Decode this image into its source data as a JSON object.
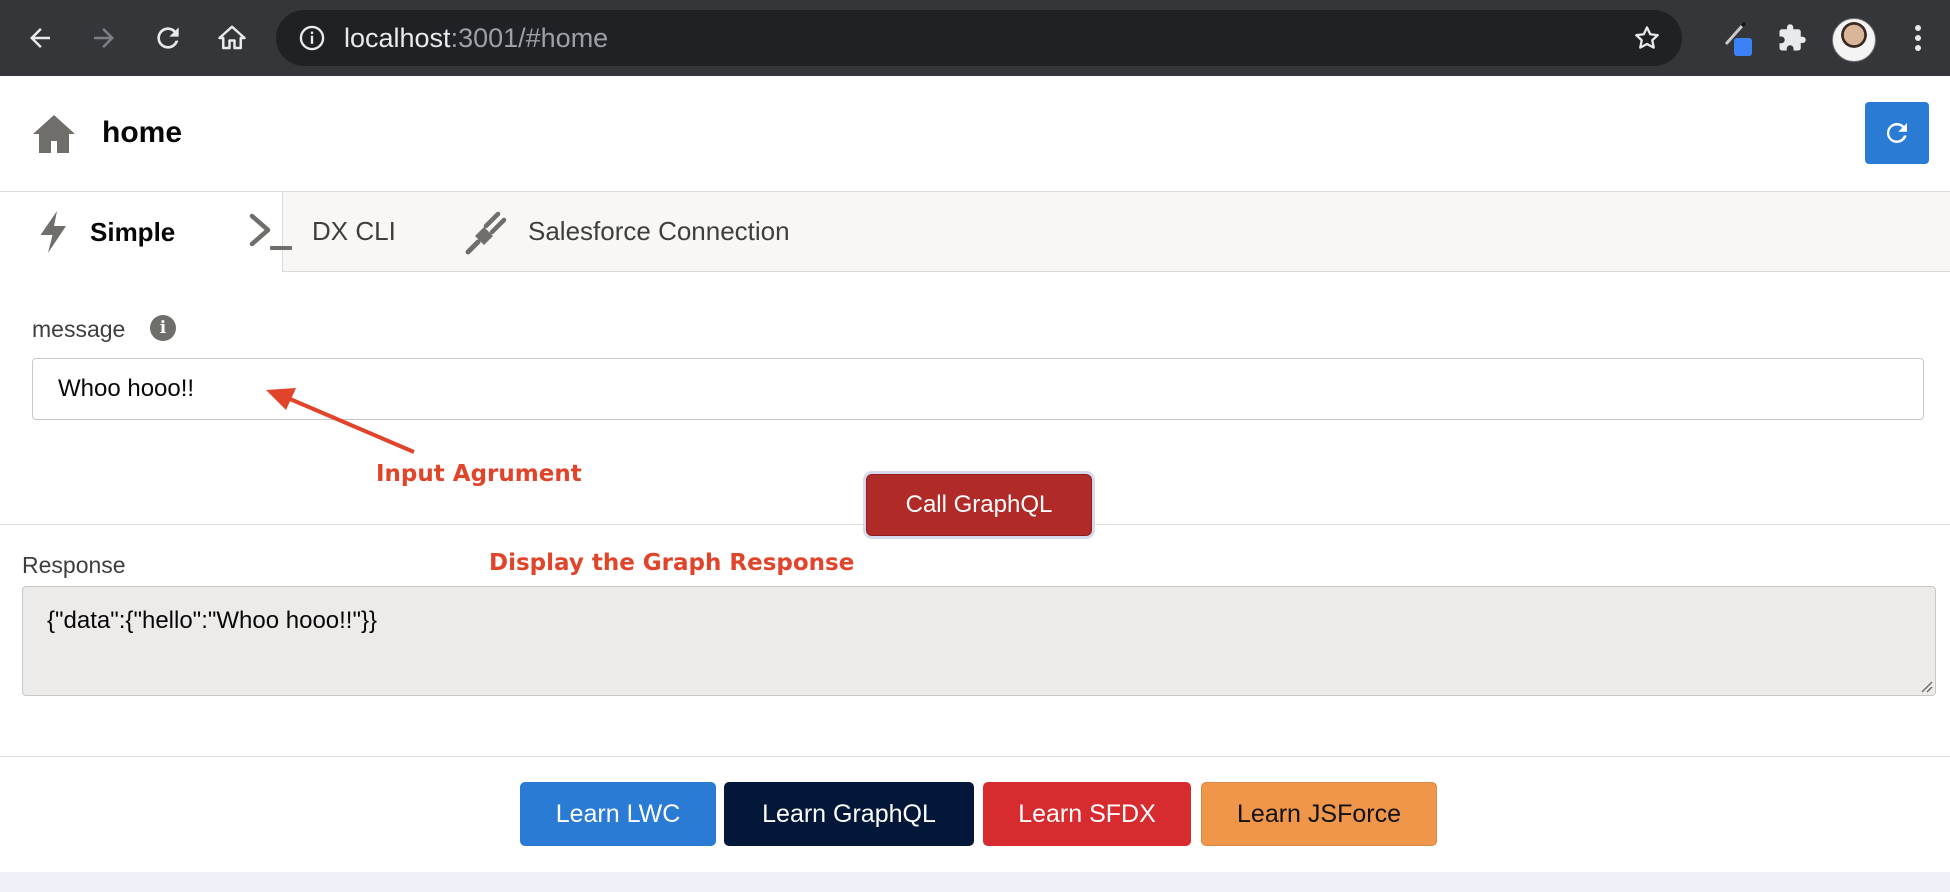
{
  "browser": {
    "url_host": "localhost",
    "url_rest": ":3001/#home"
  },
  "header": {
    "title": "home"
  },
  "tabs": [
    {
      "label": "Simple",
      "active": true
    },
    {
      "label": "DX CLI",
      "active": false
    },
    {
      "label": "Salesforce Connection",
      "active": false
    }
  ],
  "form": {
    "message_label": "message",
    "message_value": "Whoo hooo!!"
  },
  "annotations": {
    "input": "Input Agrument",
    "response": "Display the Graph Response",
    "color": "#e0442a"
  },
  "actions": {
    "call_label": "Call GraphQL"
  },
  "response": {
    "label": "Response",
    "value": "{\"data\":{\"hello\":\"Whoo hooo!!\"}}"
  },
  "learn_buttons": [
    {
      "label": "Learn LWC",
      "color": "#2a7bd3"
    },
    {
      "label": "Learn GraphQL",
      "color": "#031739"
    },
    {
      "label": "Learn SFDX",
      "color": "#d72b2f"
    },
    {
      "label": "Learn JSForce",
      "color": "#f0964a"
    }
  ],
  "colors": {
    "brand": "#2a7bd3",
    "call_button": "#b02a27"
  }
}
